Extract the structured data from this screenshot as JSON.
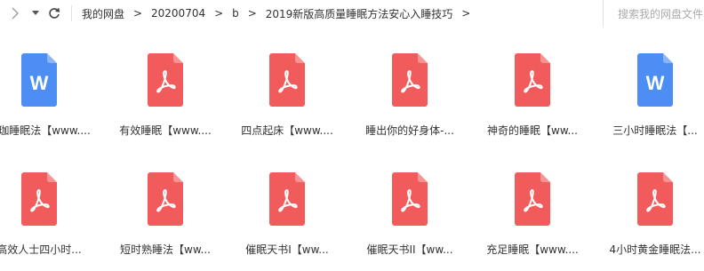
{
  "toolbar": {
    "forward_icon": "chevron-right-icon",
    "history_icon": "caret-down-icon",
    "refresh_icon": "refresh-icon"
  },
  "breadcrumb": {
    "items": [
      "我的网盘",
      "20200704",
      "b",
      "2019新版高质量睡眠方法安心入睡技巧"
    ],
    "separator": ">"
  },
  "search": {
    "placeholder": "搜索我的网盘文件"
  },
  "colors": {
    "word_blue": "#4d8ef4",
    "pdf_red": "#f25b5b"
  },
  "files": [
    {
      "name": "瑜珈睡眠法【www....",
      "type": "word"
    },
    {
      "name": "有效睡眠【www....",
      "type": "pdf"
    },
    {
      "name": "四点起床【www....",
      "type": "pdf"
    },
    {
      "name": "睡出你的好身体-...",
      "type": "pdf"
    },
    {
      "name": "神奇的睡眠【ww...",
      "type": "pdf"
    },
    {
      "name": "三小时睡眠法【...",
      "type": "word"
    },
    {
      "name": "高效人士四小时...",
      "type": "pdf"
    },
    {
      "name": "短时熟睡法【ww...",
      "type": "pdf"
    },
    {
      "name": "催眠天书I【ww...",
      "type": "pdf"
    },
    {
      "name": "催眠天书II【ww...",
      "type": "pdf"
    },
    {
      "name": "充足睡眠【www....",
      "type": "pdf"
    },
    {
      "name": "4小时黄金睡眠法...",
      "type": "pdf"
    }
  ]
}
